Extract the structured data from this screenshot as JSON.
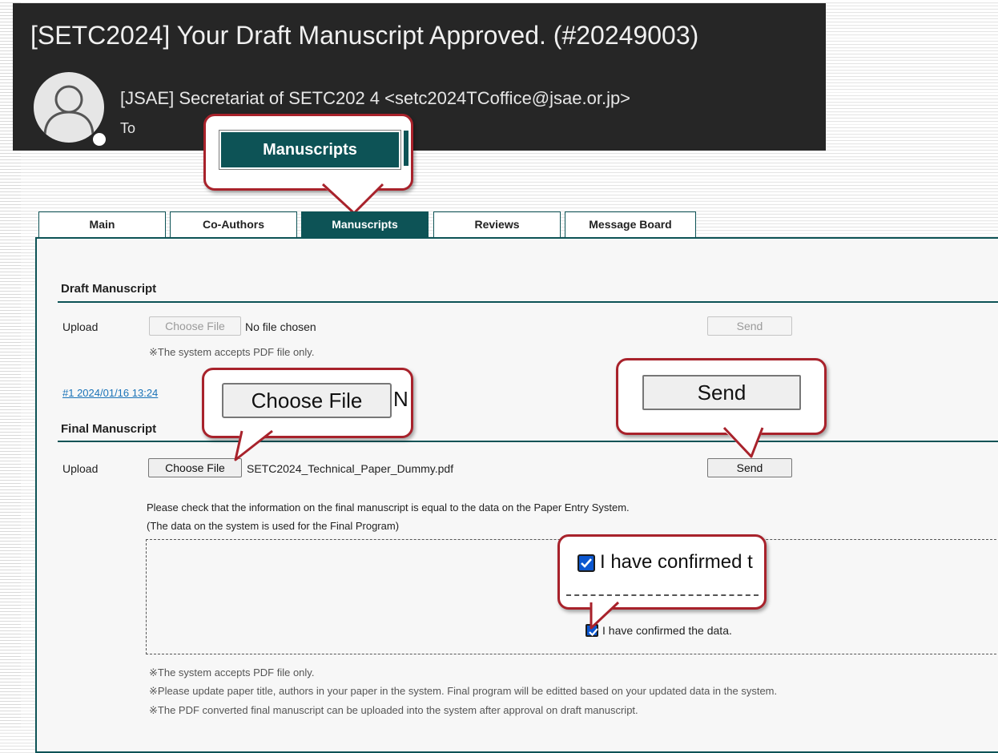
{
  "email": {
    "subject": "[SETC2024] Your Draft Manuscript Approved. (#20249003)",
    "sender": "[JSAE] Secretariat of SETC202 4  <setc2024TCoffice@jsae.or.jp>",
    "to_label": "To"
  },
  "zoom": {
    "tab_label": "Manuscripts",
    "choose_file_label": "Choose File",
    "choose_file_trailing": "N",
    "send_label": "Send",
    "checkbox_label": "I have confirmed t"
  },
  "tabs": [
    {
      "label": "Main"
    },
    {
      "label": "Co-Authors"
    },
    {
      "label": "Manuscripts",
      "active": true
    },
    {
      "label": "Reviews"
    },
    {
      "label": "Message Board"
    }
  ],
  "draft": {
    "title": "Draft Manuscript",
    "upload_label": "Upload",
    "choose_file_label": "Choose File",
    "file_status": "No file chosen",
    "send_label": "Send",
    "note": "※The system accepts PDF file only.",
    "history_link": "#1 2024/01/16 13:24"
  },
  "final": {
    "title": "Final Manuscript",
    "upload_label": "Upload",
    "choose_file_label": "Choose File",
    "file_name": "SETC2024_Technical_Paper_Dummy.pdf",
    "send_label": "Send",
    "instruction_1": "Please check that the information on the final manuscript is equal to the data on the Paper Entry System.",
    "instruction_2": "(The data on the system is used for the Final Program)",
    "confirm_label": "I have confirmed the data.",
    "notes": [
      "※The system accepts PDF file only.",
      "※Please update paper title, authors in your paper in the system. Final program will be editted based on your updated data in the system.",
      "※The PDF converted final manuscript can be uploaded into the system after approval on draft manuscript."
    ]
  },
  "colors": {
    "tab_active": "#0d5356",
    "callout_border": "#a8222b",
    "email_bg": "#262626",
    "link": "#1a73b8",
    "checkbox": "#0b57d0"
  }
}
